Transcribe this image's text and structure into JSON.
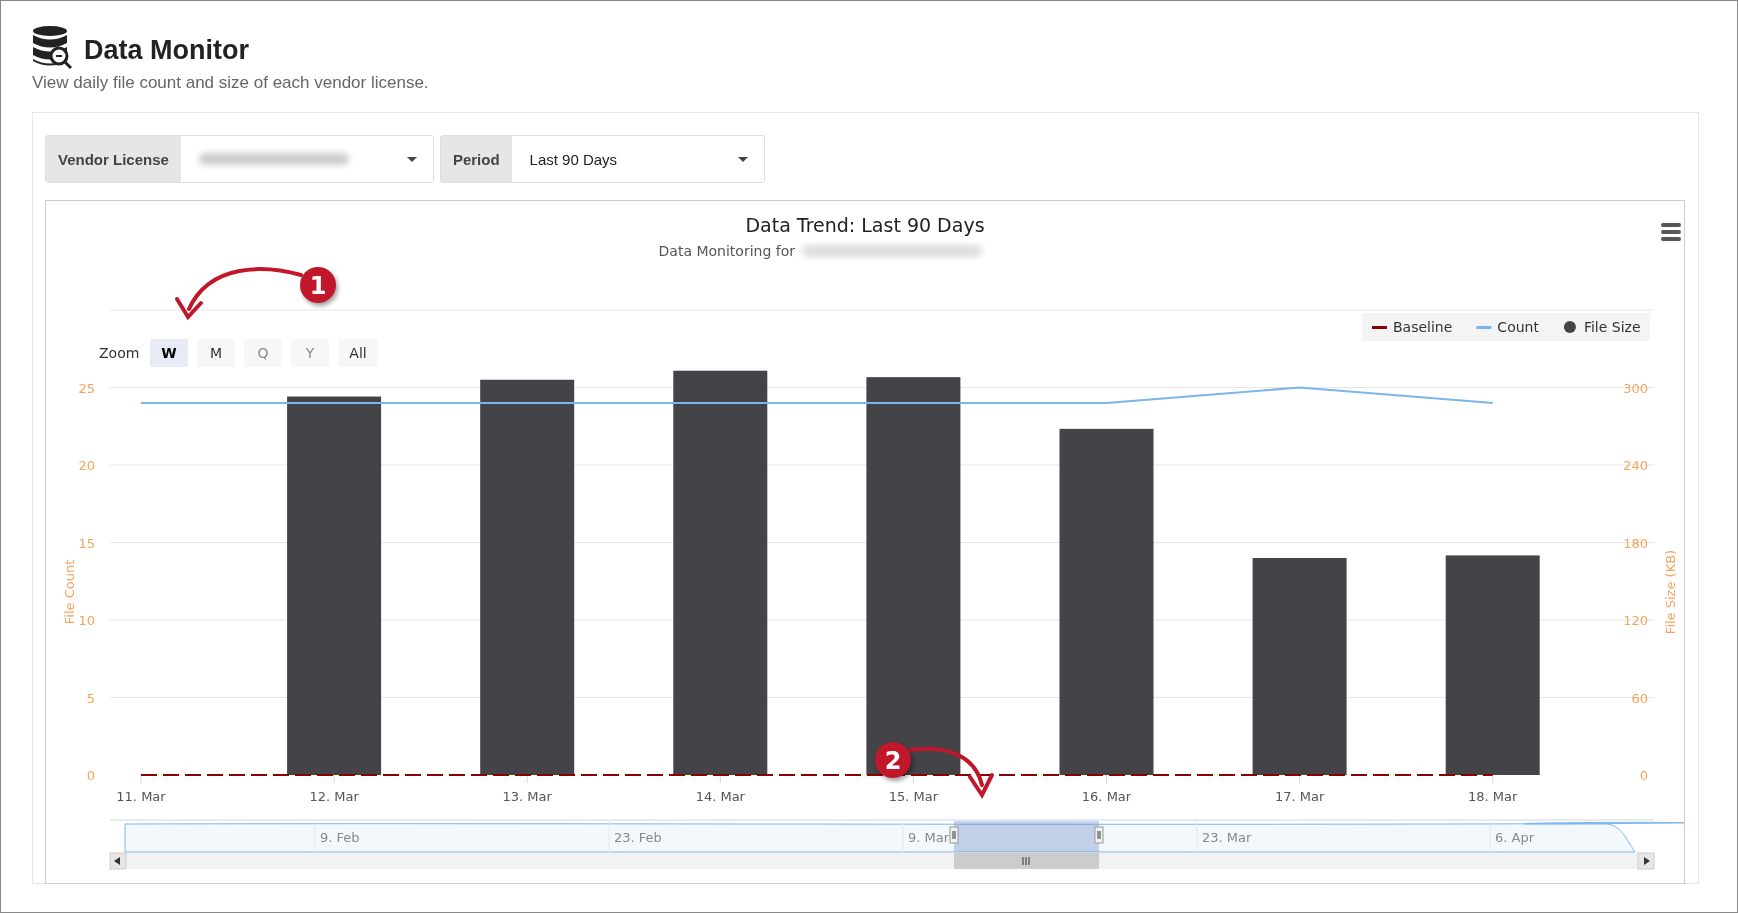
{
  "page": {
    "title": "Data Monitor",
    "description": "View daily file count and size of each vendor license."
  },
  "filters": [
    {
      "label": "Vendor License",
      "redacted": true
    },
    {
      "label": "Period",
      "value": "Last 90 Days",
      "redacted": false
    }
  ],
  "chart": {
    "subtitle": "Data Monitoring for",
    "subtitle_redacted": true,
    "zoom_label": "Zoom",
    "zoom_buttons": [
      {
        "label": "W",
        "selected": true,
        "disabled": false
      },
      {
        "label": "M",
        "selected": false,
        "disabled": false
      },
      {
        "label": "Q",
        "selected": false,
        "disabled": true
      },
      {
        "label": "Y",
        "selected": false,
        "disabled": true
      },
      {
        "label": "All",
        "selected": false,
        "disabled": false
      }
    ],
    "chart_data": {
      "type": "bar",
      "title": "Data Trend: Last 90 Days",
      "ylabel": "File Count",
      "y2label": "File Size (KB)",
      "categories": [
        "11. Mar",
        "12. Mar",
        "13. Mar",
        "14. Mar",
        "15. Mar",
        "16. Mar",
        "17. Mar",
        "18. Mar"
      ],
      "ylim": [
        0,
        30
      ],
      "y2lim": [
        0,
        360
      ],
      "grid": true,
      "legend": true,
      "yticks": [
        0,
        5,
        10,
        15,
        20,
        25
      ],
      "y2ticks": [
        0,
        60,
        120,
        180,
        240,
        300
      ],
      "series": [
        {
          "name": "Baseline",
          "color": "#8b0000",
          "type": "line",
          "line_style": "dashed",
          "values": [
            0,
            0,
            0,
            0,
            0,
            0,
            0,
            0
          ]
        },
        {
          "name": "Count",
          "color": "#7cb5ec",
          "type": "line",
          "values": [
            24,
            24,
            24,
            24,
            24,
            24,
            25,
            24
          ]
        },
        {
          "name": "File Size",
          "color": "#434348",
          "axis": "y2",
          "values": [
            0,
            293,
            306,
            313,
            308,
            268,
            168,
            170
          ]
        }
      ]
    },
    "navigator": {
      "labels": [
        "9. Feb",
        "23. Feb",
        "9. Mar",
        "23. Mar",
        "6. Apr"
      ]
    }
  },
  "callouts": [
    "1",
    "2"
  ]
}
